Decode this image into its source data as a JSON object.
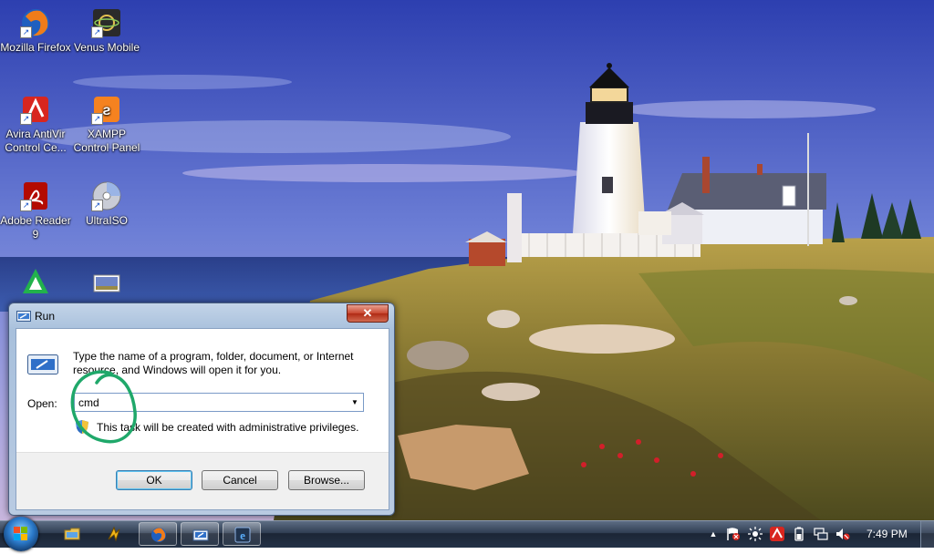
{
  "desktop": {
    "icons": [
      {
        "label": "Mozilla Firefox",
        "icon": "firefox-icon"
      },
      {
        "label": "Venus Mobile",
        "icon": "venus-mobile-icon"
      },
      {
        "label": "Avira AntiVir Control Ce...",
        "icon": "avira-icon"
      },
      {
        "label": "XAMPP Control Panel",
        "icon": "xampp-icon"
      },
      {
        "label": "Adobe Reader 9",
        "icon": "adobe-reader-icon"
      },
      {
        "label": "UltraISO",
        "icon": "ultraiso-icon"
      }
    ]
  },
  "run_dialog": {
    "title": "Run",
    "close_label": "✕",
    "description": "Type the name of a program, folder, document, or Internet resource, and Windows will open it for you.",
    "open_label": "Open:",
    "input_value": "cmd",
    "admin_note": "This task will be created with administrative privileges.",
    "ok_label": "OK",
    "cancel_label": "Cancel",
    "browse_label": "Browse..."
  },
  "taskbar": {
    "pinned": [
      "explorer-icon",
      "winamp-icon",
      "firefox-icon",
      "run-icon",
      "ie-icon"
    ],
    "tray_icons": [
      "show-hidden-icons-icon",
      "action-center-flag-icon",
      "brightness-icon",
      "avira-tray-icon",
      "battery-icon",
      "network-icon",
      "volume-muted-icon"
    ],
    "clock": "7:49 PM"
  },
  "colors": {
    "annotation_circle": "#1fa86a",
    "close_button": "#c8462f",
    "taskbar": "#243247"
  }
}
